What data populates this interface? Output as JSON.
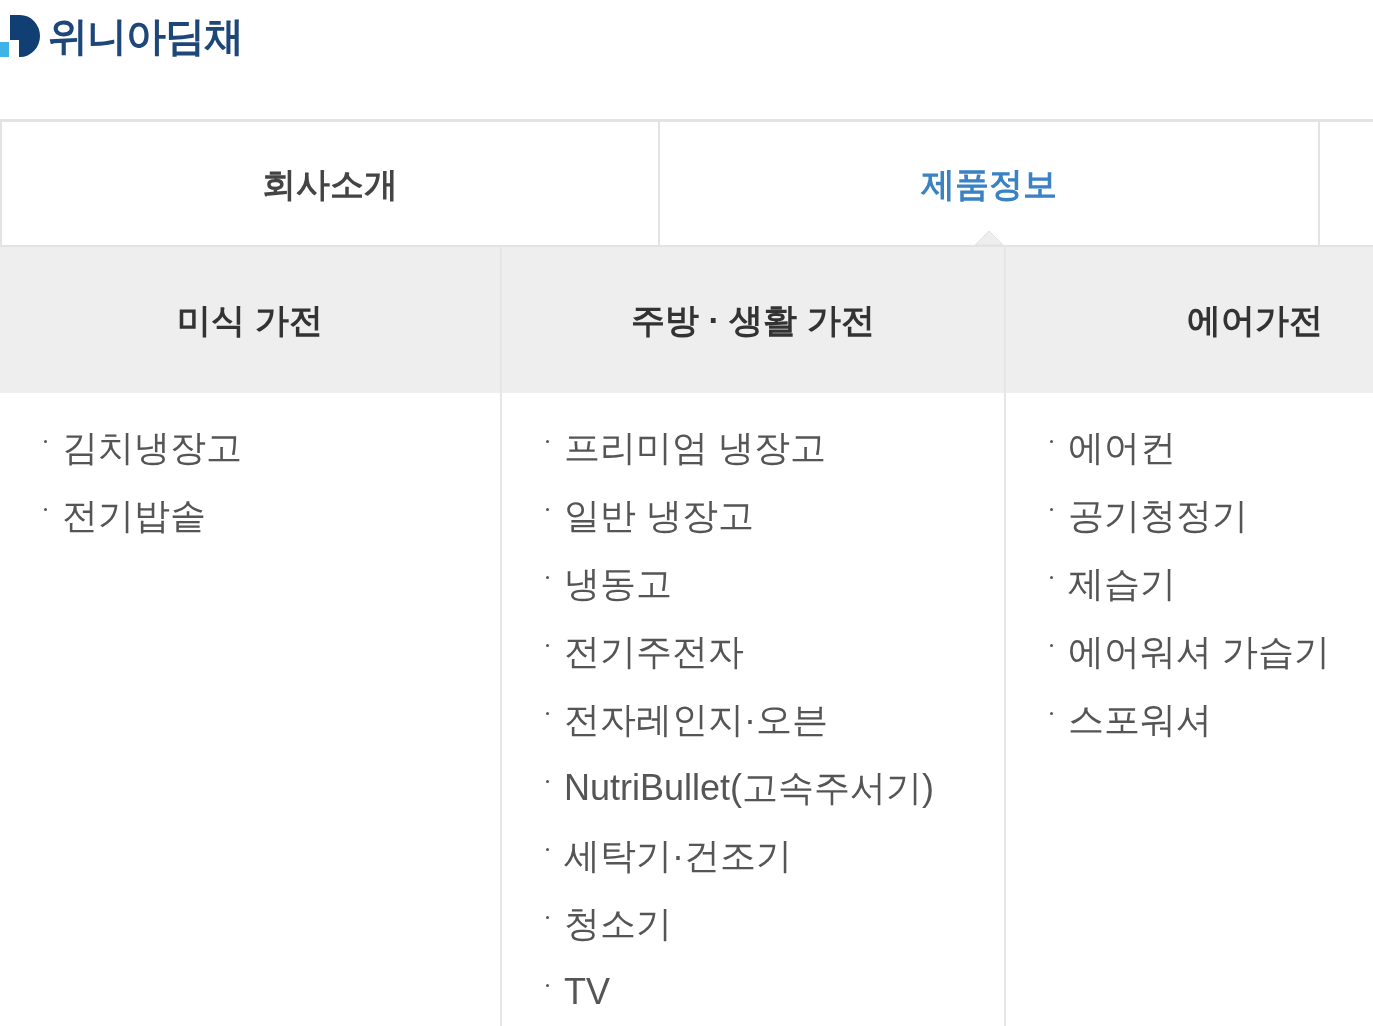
{
  "logo": {
    "text": "위니아딤채"
  },
  "tabs": [
    {
      "label": "회사소개",
      "selected": false
    },
    {
      "label": "제품정보",
      "selected": true
    }
  ],
  "menu": {
    "columns": [
      {
        "heading": "미식 가전",
        "items": [
          "김치냉장고",
          "전기밥솥"
        ]
      },
      {
        "heading": "주방 · 생활 가전",
        "items": [
          "프리미엄 냉장고",
          "일반 냉장고",
          "냉동고",
          "전기주전자",
          "전자레인지·오븐",
          "NutriBullet(고속주서기)",
          "세탁기·건조기",
          "청소기",
          "TV"
        ]
      },
      {
        "heading": "에어가전",
        "items": [
          "에어컨",
          "공기청정기",
          "제습기",
          "에어워셔 가습기",
          "스포워셔"
        ]
      }
    ]
  }
}
